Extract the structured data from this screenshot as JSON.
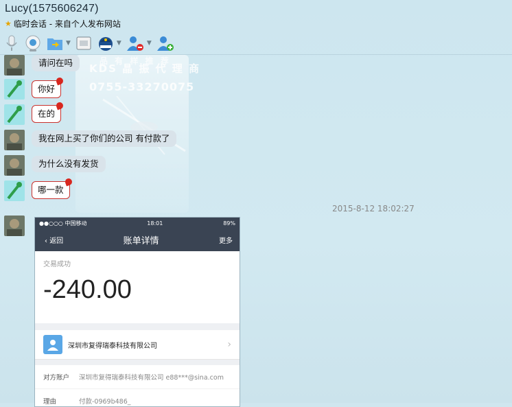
{
  "window": {
    "title": "Lucy(1575606247)",
    "subtitle": "临时会话 - 来自个人发布网站"
  },
  "toolbar": {
    "icons": [
      "microphone-icon",
      "video-camera-icon",
      "file-transfer-icon",
      "screen-share-icon",
      "police-icon",
      "remove-user-icon",
      "add-user-icon"
    ]
  },
  "watermark": {
    "line0": "品 有 样 推 荐 ",
    "line1": "KDS 晶 振 代 理 商",
    "line2": "0755-33270075"
  },
  "messages": [
    {
      "who": "lucy",
      "text": "请问在吗"
    },
    {
      "who": "me",
      "text": "你好"
    },
    {
      "who": "me",
      "text": "在的"
    },
    {
      "who": "lucy",
      "text": "我在网上买了你们的公司  有付款了"
    },
    {
      "who": "lucy",
      "text": "为什么没有发货"
    },
    {
      "who": "me",
      "text": "哪一款"
    }
  ],
  "timestamp": "2015-8-12 18:02:27",
  "receipt": {
    "carrier": "●●○○○ 中国移动",
    "time": "18:01",
    "battery": "89%",
    "back": "返回",
    "title": "账单详情",
    "more": "更多",
    "status": "交易成功",
    "amount": "-240.00",
    "merchant": "深圳市复得瑞泰科技有限公司",
    "rows": [
      {
        "key": "对方账户",
        "value": "深圳市复得瑞泰科技有限公司 e88***@sina.com"
      },
      {
        "key": "理由",
        "value": "付款-0969b486_"
      }
    ]
  },
  "colors": {
    "accent": "#3a4453",
    "bubble_me_border": "#c9302c",
    "bubble_them": "#d9e3ea"
  }
}
